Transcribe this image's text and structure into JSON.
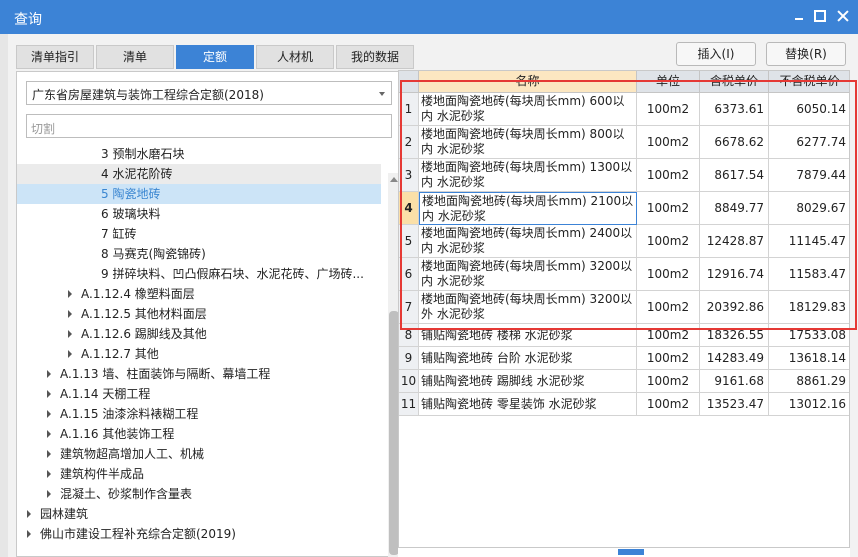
{
  "window": {
    "title": "查询"
  },
  "tabs": [
    "清单指引",
    "清单",
    "定额",
    "人材机",
    "我的数据"
  ],
  "toolbar": {
    "insert_label": "插入(I)",
    "replace_label": "替换(R)"
  },
  "library": {
    "selected": "广东省房屋建筑与装饰工程综合定额(2018)"
  },
  "search": {
    "placeholder": "切割"
  },
  "tree": [
    {
      "label": "3 预制水磨石块",
      "level": 3,
      "expander": false,
      "state": ""
    },
    {
      "label": "4 水泥花阶砖",
      "level": 3,
      "expander": false,
      "state": "gray"
    },
    {
      "label": "5 陶瓷地砖",
      "level": 3,
      "expander": false,
      "state": "selected"
    },
    {
      "label": "6 玻璃块料",
      "level": 3,
      "expander": false,
      "state": ""
    },
    {
      "label": "7 缸砖",
      "level": 3,
      "expander": false,
      "state": ""
    },
    {
      "label": "8 马赛克(陶瓷锦砖)",
      "level": 3,
      "expander": false,
      "state": ""
    },
    {
      "label": "9 拼碎块料、凹凸假麻石块、水泥花砖、广场砖...",
      "level": 3,
      "expander": false,
      "state": ""
    },
    {
      "label": "A.1.12.4 橡塑料面层",
      "level": 2,
      "expander": true,
      "state": ""
    },
    {
      "label": "A.1.12.5 其他材料面层",
      "level": 2,
      "expander": true,
      "state": ""
    },
    {
      "label": "A.1.12.6 踢脚线及其他",
      "level": 2,
      "expander": true,
      "state": ""
    },
    {
      "label": "A.1.12.7 其他",
      "level": 2,
      "expander": true,
      "state": ""
    },
    {
      "label": "A.1.13 墙、柱面装饰与隔断、幕墙工程",
      "level": 1,
      "expander": true,
      "state": ""
    },
    {
      "label": "A.1.14 天棚工程",
      "level": 1,
      "expander": true,
      "state": ""
    },
    {
      "label": "A.1.15 油漆涂料裱糊工程",
      "level": 1,
      "expander": true,
      "state": ""
    },
    {
      "label": "A.1.16 其他装饰工程",
      "level": 1,
      "expander": true,
      "state": ""
    },
    {
      "label": "建筑物超高增加人工、机械",
      "level": 1,
      "expander": true,
      "state": ""
    },
    {
      "label": "建筑构件半成品",
      "level": 1,
      "expander": true,
      "state": ""
    },
    {
      "label": "混凝土、砂浆制作含量表",
      "level": 1,
      "expander": true,
      "state": ""
    },
    {
      "label": "园林建筑",
      "level": 0,
      "expander": true,
      "state": ""
    },
    {
      "label": "佛山市建设工程补充综合定额(2019)",
      "level": 0,
      "expander": true,
      "state": ""
    }
  ],
  "table": {
    "headers": {
      "name": "名称",
      "unit": "单位",
      "tax_price": "含税单价",
      "notax_price": "不含税单价"
    },
    "rows": [
      {
        "n": "1",
        "name": "楼地面陶瓷地砖(每块周长mm) 600以内 水泥砂浆",
        "unit": "100m2",
        "tax": "6373.61",
        "notax": "6050.14"
      },
      {
        "n": "2",
        "name": "楼地面陶瓷地砖(每块周长mm) 800以内 水泥砂浆",
        "unit": "100m2",
        "tax": "6678.62",
        "notax": "6277.74"
      },
      {
        "n": "3",
        "name": "楼地面陶瓷地砖(每块周长mm) 1300以内 水泥砂浆",
        "unit": "100m2",
        "tax": "8617.54",
        "notax": "7879.44"
      },
      {
        "n": "4",
        "name": "楼地面陶瓷地砖(每块周长mm) 2100以内 水泥砂浆",
        "unit": "100m2",
        "tax": "8849.77",
        "notax": "8029.67"
      },
      {
        "n": "5",
        "name": "楼地面陶瓷地砖(每块周长mm) 2400以内 水泥砂浆",
        "unit": "100m2",
        "tax": "12428.87",
        "notax": "11145.47"
      },
      {
        "n": "6",
        "name": "楼地面陶瓷地砖(每块周长mm) 3200以内 水泥砂浆",
        "unit": "100m2",
        "tax": "12916.74",
        "notax": "11583.47"
      },
      {
        "n": "7",
        "name": "楼地面陶瓷地砖(每块周长mm) 3200以外 水泥砂浆",
        "unit": "100m2",
        "tax": "20392.86",
        "notax": "18129.83"
      },
      {
        "n": "8",
        "name": "铺贴陶瓷地砖 楼梯 水泥砂浆",
        "unit": "100m2",
        "tax": "18326.55",
        "notax": "17533.08"
      },
      {
        "n": "9",
        "name": "铺贴陶瓷地砖 台阶 水泥砂浆",
        "unit": "100m2",
        "tax": "14283.49",
        "notax": "13618.14"
      },
      {
        "n": "10",
        "name": "铺贴陶瓷地砖 踢脚线 水泥砂浆",
        "unit": "100m2",
        "tax": "9161.68",
        "notax": "8861.29"
      },
      {
        "n": "11",
        "name": "铺贴陶瓷地砖 零星装饰 水泥砂浆",
        "unit": "100m2",
        "tax": "13523.47",
        "notax": "13012.16"
      }
    ],
    "current_row": "4"
  },
  "colors": {
    "accent": "#3c83d6",
    "highlight": "#e53935",
    "tree_selected_bg": "#cce4f7",
    "header_name_bg": "#fce7c1"
  }
}
